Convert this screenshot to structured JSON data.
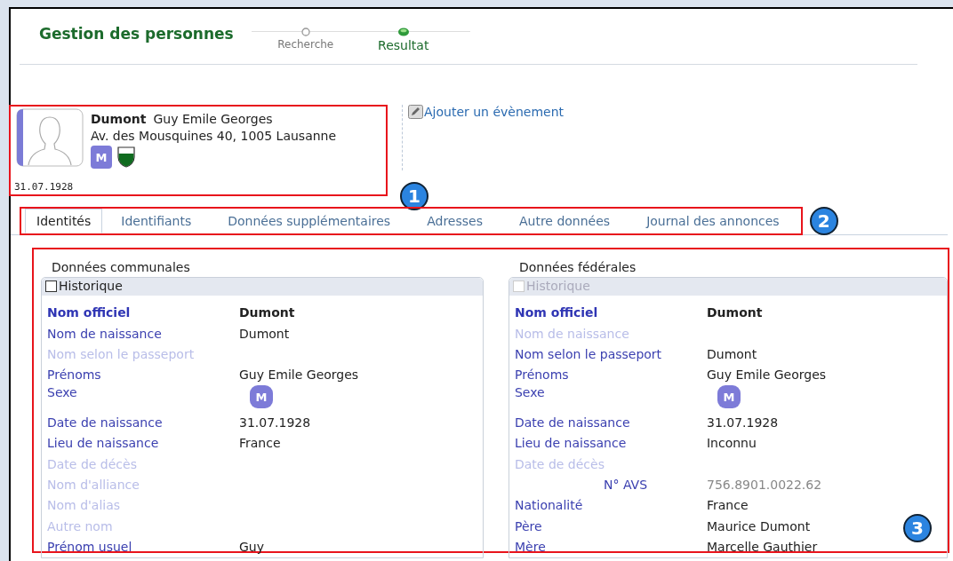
{
  "header": {
    "title": "Gestion des personnes",
    "steps": [
      {
        "label": "Recherche",
        "selected": false
      },
      {
        "label": "Resultat",
        "selected": true
      }
    ]
  },
  "person": {
    "last_name": "Dumont",
    "first_names": "Guy Emile Georges",
    "address": "Av. des Mousquines 40, 1005 Lausanne",
    "sex": "M",
    "birth_date": "31.07.1928",
    "callout": "1"
  },
  "event_link": "Ajouter un évènement",
  "tabs": {
    "items": [
      {
        "label": "Identités",
        "selected": true
      },
      {
        "label": "Identifiants",
        "selected": false
      },
      {
        "label": "Données supplémentaires",
        "selected": false
      },
      {
        "label": "Adresses",
        "selected": false
      },
      {
        "label": "Autre données",
        "selected": false
      },
      {
        "label": "Journal des annonces",
        "selected": false
      }
    ],
    "callout": "2"
  },
  "sections_callout": "3",
  "sections": [
    {
      "title": "Données communales",
      "history": {
        "label": "Historique",
        "checked": false,
        "disabled": false
      },
      "rows": [
        {
          "kind": "text",
          "label": "Nom officiel",
          "value": "Dumont",
          "emphasis": true,
          "disabled": false
        },
        {
          "kind": "text",
          "label": "Nom de naissance",
          "value": "Dumont",
          "emphasis": false,
          "disabled": false
        },
        {
          "kind": "text",
          "label": "Nom selon le passeport",
          "emphasis": false,
          "disabled": true
        },
        {
          "kind": "text",
          "label": "Prénoms",
          "value": "Guy Emile Georges",
          "emphasis": false,
          "disabled": false
        },
        {
          "kind": "sex",
          "label": "Sexe",
          "value": "M",
          "emphasis": false,
          "disabled": false
        },
        {
          "kind": "text",
          "label": "Date de naissance",
          "value": "31.07.1928",
          "emphasis": false,
          "disabled": false
        },
        {
          "kind": "text",
          "label": "Lieu de naissance",
          "value": "France",
          "emphasis": false,
          "disabled": false
        },
        {
          "kind": "text",
          "label": "Date de décès",
          "emphasis": false,
          "disabled": true
        },
        {
          "kind": "text",
          "label": "Nom d'alliance",
          "emphasis": false,
          "disabled": true
        },
        {
          "kind": "text",
          "label": "Nom d'alias",
          "emphasis": false,
          "disabled": true
        },
        {
          "kind": "text",
          "label": "Autre nom",
          "emphasis": false,
          "disabled": true
        },
        {
          "kind": "text",
          "label": "Prénom usuel",
          "value": "Guy",
          "emphasis": false,
          "disabled": false
        }
      ]
    },
    {
      "title": "Données fédérales",
      "history": {
        "label": "Historique",
        "checked": false,
        "disabled": true
      },
      "rows": [
        {
          "kind": "text",
          "label": "Nom officiel",
          "value": "Dumont",
          "emphasis": true,
          "disabled": false
        },
        {
          "kind": "text",
          "label": "Nom de naissance",
          "emphasis": false,
          "disabled": true
        },
        {
          "kind": "text",
          "label": "Nom selon le passeport",
          "value": "Dumont",
          "emphasis": false,
          "disabled": false
        },
        {
          "kind": "text",
          "label": "Prénoms",
          "value": "Guy Emile Georges",
          "emphasis": false,
          "disabled": false
        },
        {
          "kind": "sex",
          "label": "Sexe",
          "value": "M",
          "emphasis": false,
          "disabled": false
        },
        {
          "kind": "text",
          "label": "Date de naissance",
          "value": "31.07.1928",
          "emphasis": false,
          "disabled": false
        },
        {
          "kind": "text",
          "label": "Lieu de naissance",
          "value": "Inconnu",
          "emphasis": false,
          "disabled": false
        },
        {
          "kind": "text",
          "label": "Date de décès",
          "emphasis": false,
          "disabled": true
        },
        {
          "kind": "avs",
          "label": "N° AVS",
          "value": "756.8901.0022.62",
          "emphasis": false,
          "disabled": false
        },
        {
          "kind": "text",
          "label": "Nationalité",
          "value": "France",
          "emphasis": false,
          "disabled": false
        },
        {
          "kind": "text",
          "label": "Père",
          "value": "Maurice Dumont",
          "emphasis": false,
          "disabled": false
        },
        {
          "kind": "text",
          "label": "Mère",
          "value": "Marcelle Gauthier",
          "emphasis": false,
          "disabled": false
        }
      ]
    }
  ]
}
